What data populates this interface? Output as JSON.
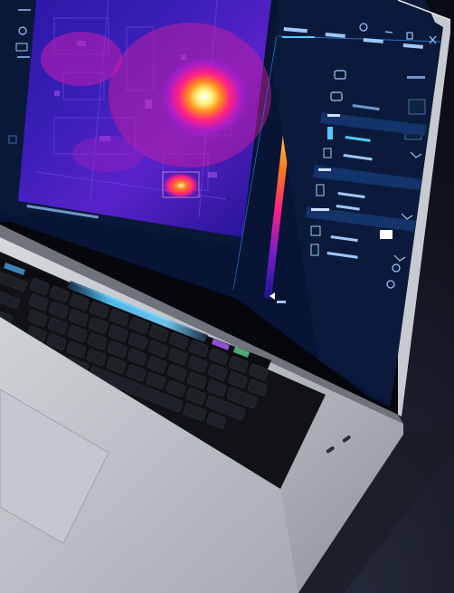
{
  "scene": {
    "description_type": "product-photo",
    "subject": "laptop-displaying-thermal-camera-software",
    "colors": {
      "background": "#0d1019",
      "laptop_body": "#bfc3c9",
      "keyboard": "#111216",
      "touchbar_accent": "#56c9ff",
      "panel_bg": "#0b1a3a",
      "panel_line": "#2a6bc9",
      "hot_spot": "#ffffff",
      "thermal_mid": "#ff2aa0",
      "thermal_low": "#2a1aa8"
    }
  },
  "screen": {
    "left_toolbar": [
      {
        "icon": "refresh-icon"
      },
      {
        "icon": "image-icon"
      }
    ],
    "panel_tabs": [
      {
        "icon": "tab-icon-1"
      },
      {
        "icon": "tab-icon-2"
      },
      {
        "icon": "tab-icon-3"
      },
      {
        "icon": "tab-icon-4"
      }
    ],
    "window_controls": [
      "gear-icon",
      "minimize-icon",
      "maximize-icon",
      "close-icon"
    ],
    "scale": {
      "top_value_marker": "tick",
      "bottom_value_marker": "tick"
    },
    "panel_rows": 6
  },
  "laptop": {
    "keyboard_rows": 6
  }
}
